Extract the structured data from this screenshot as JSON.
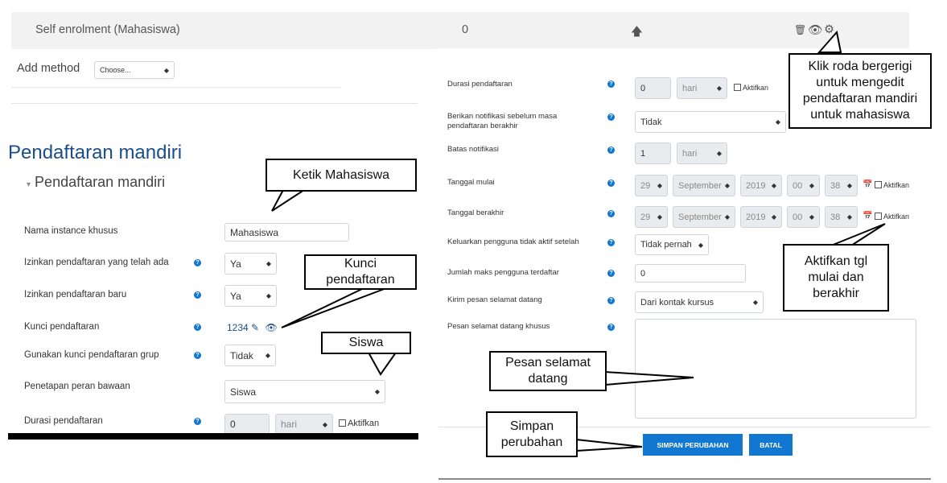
{
  "top_row": {
    "method": "Self enrolment (Mahasiswa)",
    "count": "0"
  },
  "add_method": {
    "label": "Add method",
    "select": "Choose..."
  },
  "left": {
    "title": "Pendaftaran mandiri",
    "section": "Pendaftaran mandiri",
    "rows": [
      {
        "label": "Nama instance khusus",
        "value": "Mahasiswa"
      },
      {
        "label": "Izinkan pendaftaran yang telah ada",
        "value": "Ya"
      },
      {
        "label": "Izinkan pendaftaran baru",
        "value": "Ya"
      },
      {
        "label": "Kunci pendaftaran",
        "value": "1234"
      },
      {
        "label": "Gunakan kunci pendaftaran grup",
        "value": "Tidak"
      },
      {
        "label": "Penetapan peran bawaan",
        "value": "Siswa"
      },
      {
        "label": "Durasi pendaftaran",
        "value": "0",
        "unit": "hari",
        "check": "Aktifkan"
      }
    ]
  },
  "right": {
    "rows": [
      {
        "label": "Durasi pendaftaran",
        "value": "0",
        "unit": "hari",
        "check": "Aktifkan"
      },
      {
        "label": "Berikan notifikasi sebelum masa pendaftaran berakhir",
        "value": "Tidak"
      },
      {
        "label": "Batas notifikasi",
        "value": "1",
        "unit": "hari"
      },
      {
        "label": "Tanggal mulai",
        "day": "29",
        "month": "September",
        "year": "2019",
        "hour": "00",
        "minute": "38",
        "check": "Aktifkan"
      },
      {
        "label": "Tanggal berakhir",
        "day": "29",
        "month": "September",
        "year": "2019",
        "hour": "00",
        "minute": "38",
        "check": "Aktifkan"
      },
      {
        "label": "Keluarkan pengguna tidak aktif setelah",
        "value": "Tidak pernah"
      },
      {
        "label": "Jumlah maks pengguna terdaftar",
        "value": "0"
      },
      {
        "label": "Kirim pesan selamat datang",
        "value": "Dari kontak kursus"
      },
      {
        "label": "Pesan selamat datang khusus",
        "value": ""
      }
    ],
    "save_button": "SIMPAN PERUBAHAN",
    "cancel_button": "BATAL"
  },
  "callouts": {
    "gear": "Klik roda bergerigi untuk mengedit pendaftaran mandiri untuk mahasiswa",
    "ketik": "Ketik Mahasiswa",
    "kunci": "Kunci pendaftaran",
    "siswa": "Siswa",
    "aktifkan": "Aktifkan tgl mulai dan berakhir",
    "pesan": "Pesan selamat datang",
    "simpan": "Simpan perubahan"
  },
  "icons": {
    "up": "arrow-up-icon",
    "delete": "trash-icon",
    "view": "eye-icon",
    "settings": "gear-icon",
    "calendar": "calendar-icon",
    "edit": "pencil-icon"
  },
  "colors": {
    "accent": "#1177d1",
    "icon": "#0f3d6e"
  }
}
